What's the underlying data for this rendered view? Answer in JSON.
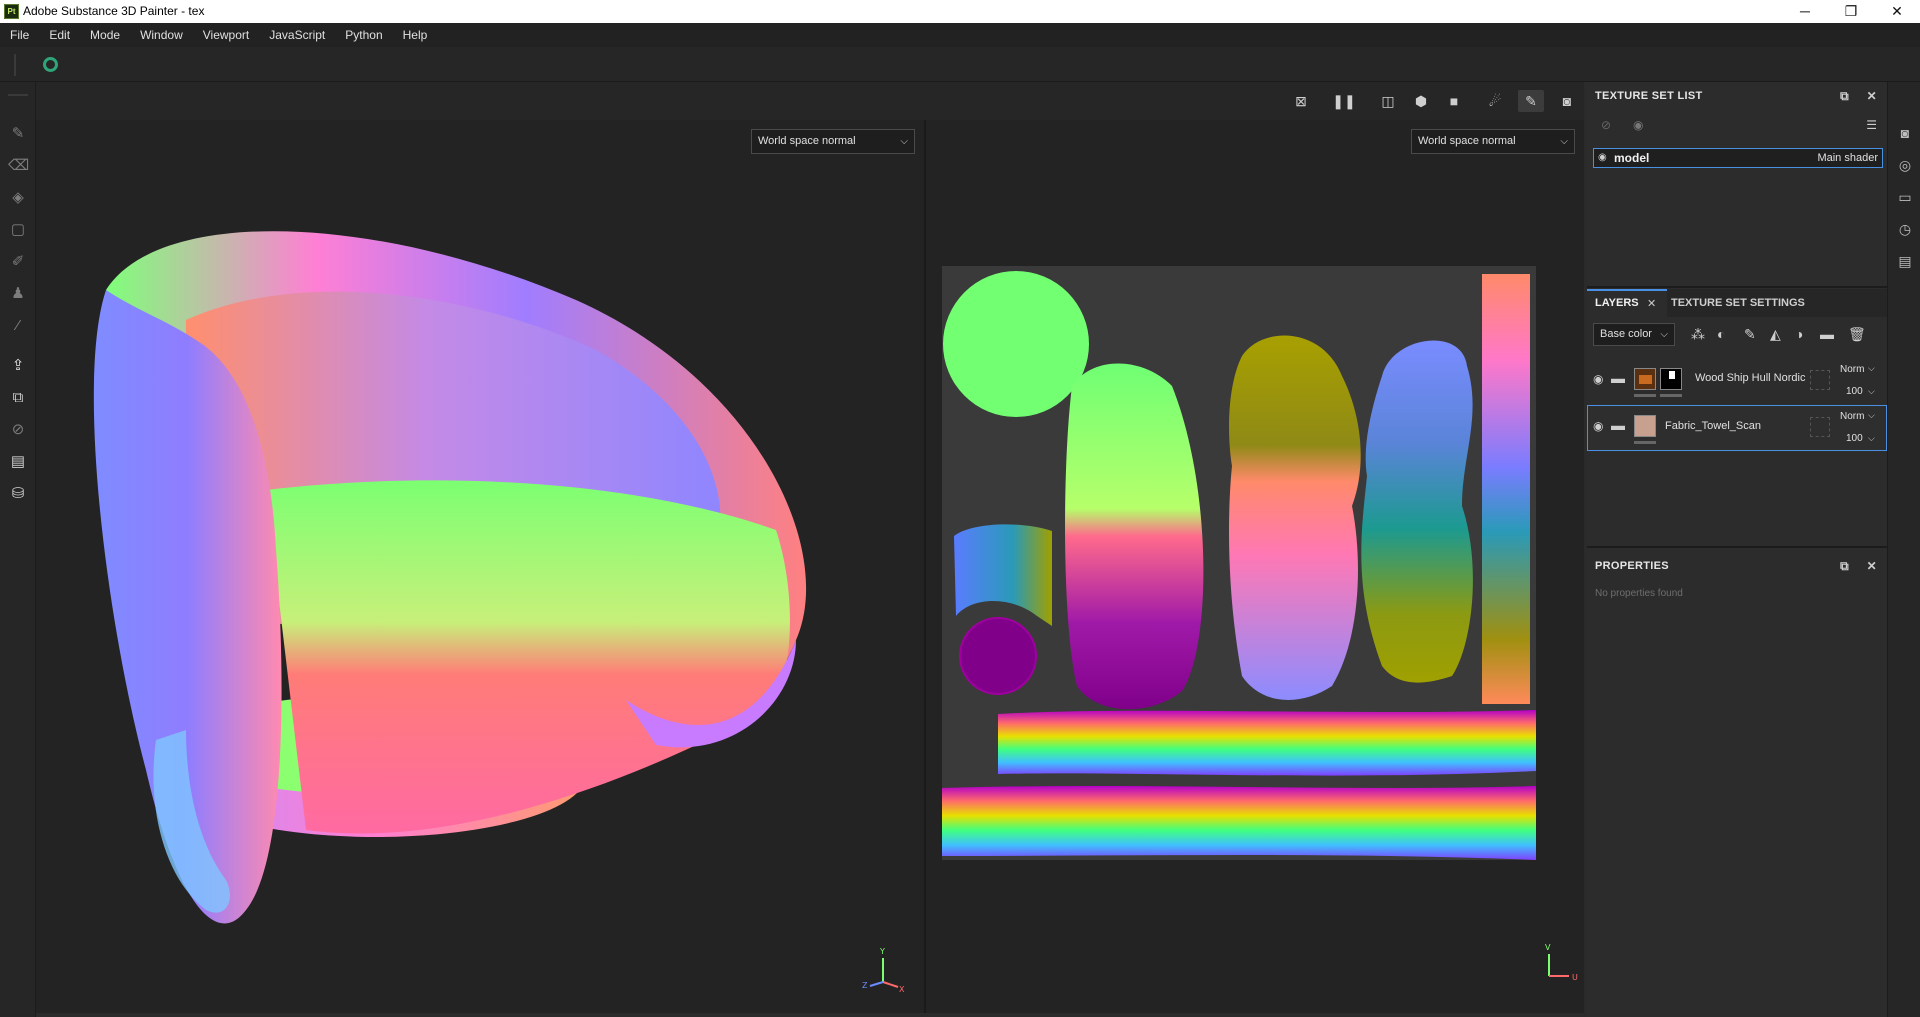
{
  "window": {
    "title": "Adobe Substance 3D Painter - tex",
    "logo_text": "Pt",
    "minimize": "─",
    "maximize": "❐",
    "close": "✕"
  },
  "menu": [
    "File",
    "Edit",
    "Mode",
    "Window",
    "Viewport",
    "JavaScript",
    "Python",
    "Help"
  ],
  "viewport": {
    "left_mode": "World space normal",
    "right_mode": "World space normal",
    "left_axes": {
      "y": "Y",
      "z": "Z",
      "x": "X"
    },
    "right_axes": {
      "v": "V",
      "u": "U"
    }
  },
  "texture_set_list": {
    "title": "TEXTURE SET LIST",
    "item_name": "model",
    "item_shader": "Main shader"
  },
  "layers_panel": {
    "tab_layers": "LAYERS",
    "tab_texture_set_settings": "TEXTURE SET SETTINGS",
    "channel": "Base color",
    "layers": [
      {
        "name": "Wood Ship Hull Nordic",
        "blend": "Norm",
        "opacity": "100"
      },
      {
        "name": "Fabric_Towel_Scan",
        "blend": "Norm",
        "opacity": "100"
      }
    ]
  },
  "properties": {
    "title": "PROPERTIES",
    "empty_text": "No properties found"
  },
  "colors": {
    "accent": "#4a90e2",
    "background": "#2b2b2b",
    "viewport": "#232323"
  }
}
